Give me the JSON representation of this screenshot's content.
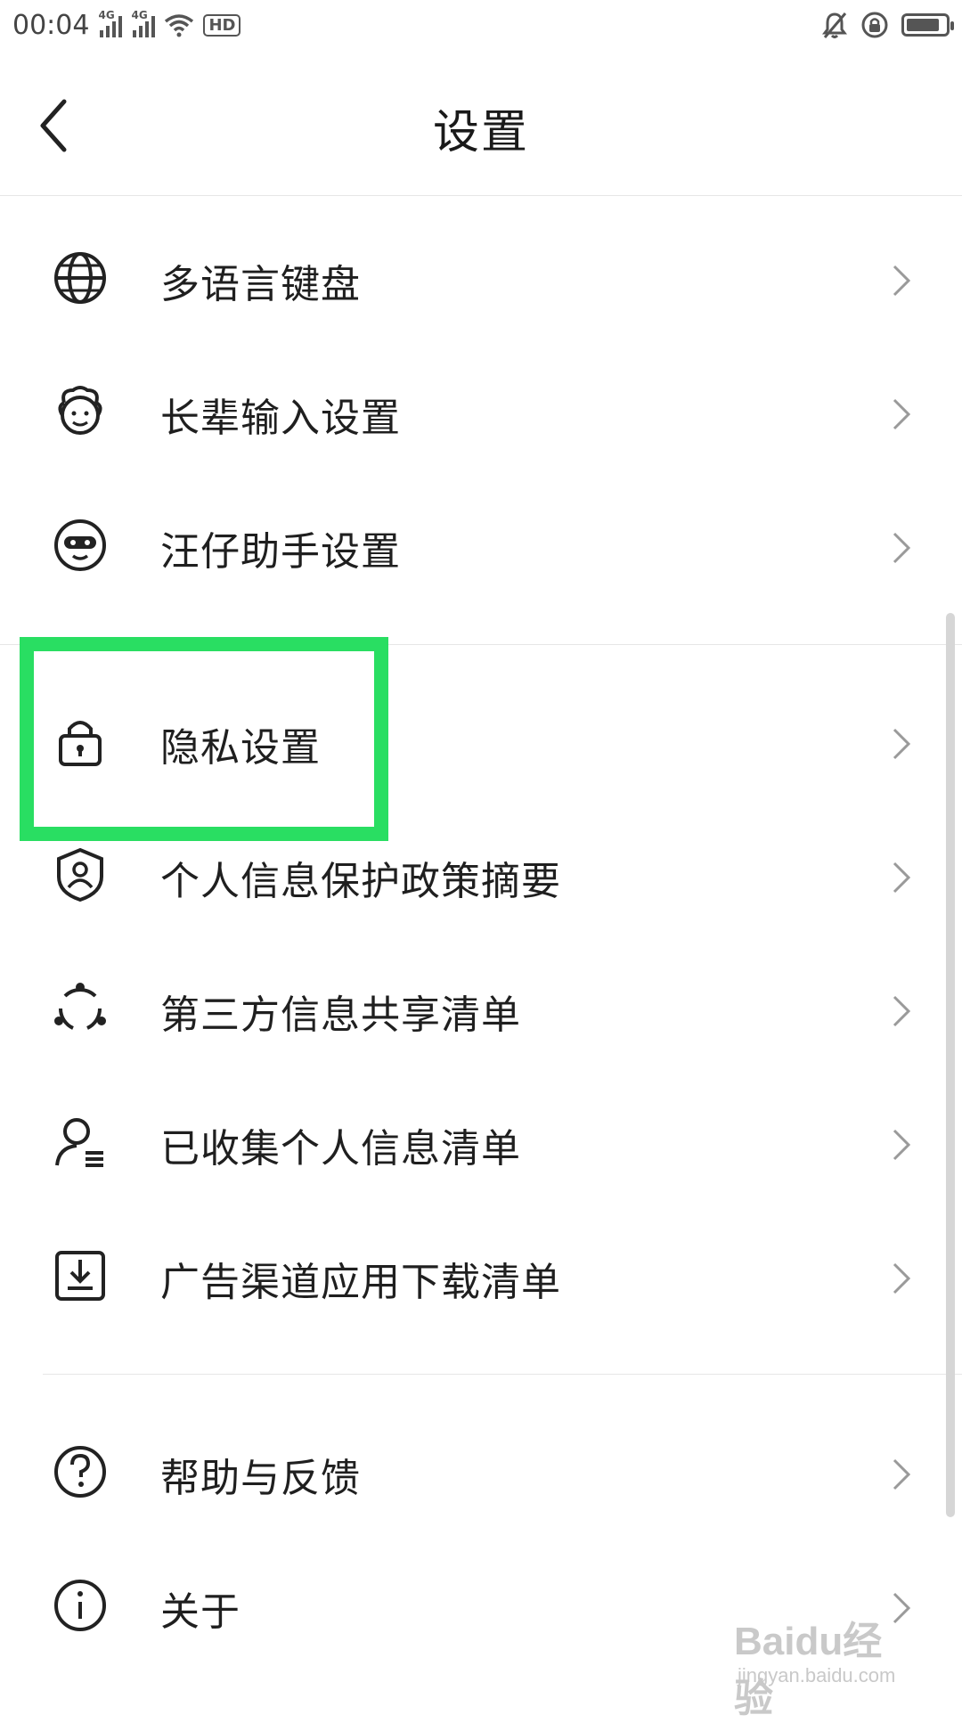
{
  "status_bar": {
    "time": "00:04",
    "network1": "4G",
    "network2": "4G",
    "hd_badge": "HD",
    "battery_level": 0.85
  },
  "header": {
    "title": "设置"
  },
  "items": [
    {
      "label": "多语言键盘",
      "icon": "globe-icon"
    },
    {
      "label": "长辈输入设置",
      "icon": "elder-face-icon"
    },
    {
      "label": "汪仔助手设置",
      "icon": "assistant-face-icon"
    },
    {
      "label": "隐私设置",
      "icon": "lock-icon"
    },
    {
      "label": "个人信息保护政策摘要",
      "icon": "shield-user-icon"
    },
    {
      "label": "第三方信息共享清单",
      "icon": "share-circle-icon"
    },
    {
      "label": "已收集个人信息清单",
      "icon": "user-list-icon"
    },
    {
      "label": "广告渠道应用下载清单",
      "icon": "download-box-icon"
    },
    {
      "label": "帮助与反馈",
      "icon": "help-circle-icon"
    },
    {
      "label": "关于",
      "icon": "info-circle-icon"
    }
  ],
  "watermark": {
    "main": "Baidu经验",
    "sub": "jingyan.baidu.com"
  },
  "colors": {
    "highlight": "#29de62",
    "text": "#1f1f1f",
    "chevron": "#9a9a9a"
  }
}
